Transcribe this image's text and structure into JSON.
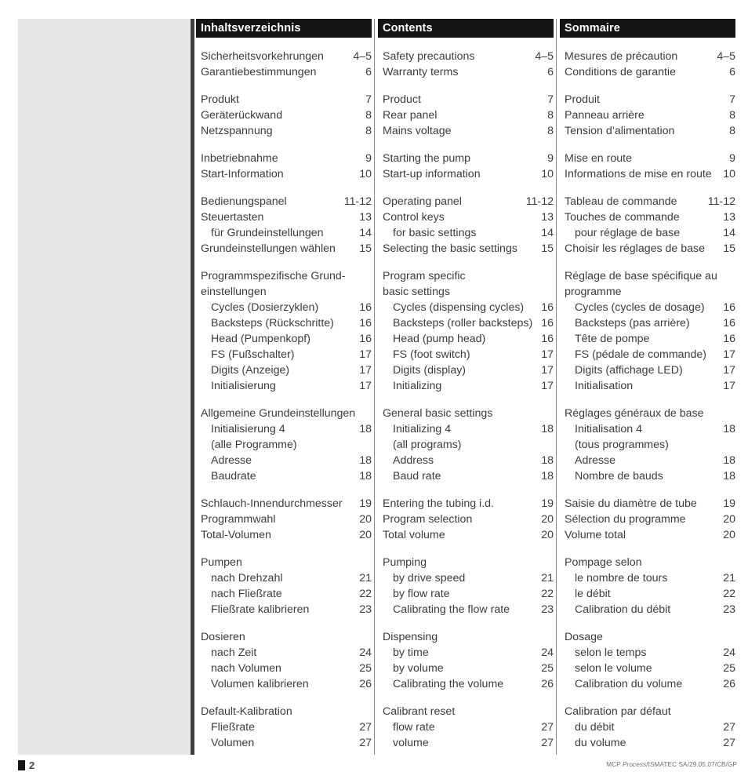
{
  "document": {
    "footer": {
      "page_marker": "square-marker",
      "page_number": "2",
      "reference_prefix": "MCP ",
      "reference_italic": "Process",
      "reference_suffix": "/ISMATEC SA/29.05.07/CB/GP"
    }
  },
  "columns": [
    {
      "id": "de",
      "language": "German",
      "header": "Inhaltsverzeichnis",
      "groups": [
        {
          "rows": [
            {
              "label": "Sicherheitsvorkehrungen",
              "page": "4–5",
              "indent": false
            },
            {
              "label": "Garantiebestimmungen",
              "page": "6",
              "indent": false
            }
          ]
        },
        {
          "rows": [
            {
              "label": "Produkt",
              "page": "7",
              "indent": false
            },
            {
              "label": "Geräterückwand",
              "page": "8",
              "indent": false
            },
            {
              "label": "Netzspannung",
              "page": "8",
              "indent": false
            }
          ]
        },
        {
          "rows": [
            {
              "label": "Inbetriebnahme",
              "page": "9",
              "indent": false
            },
            {
              "label": "Start-Information",
              "page": "10",
              "indent": false
            }
          ]
        },
        {
          "rows": [
            {
              "label": "Bedienungspanel",
              "page": "11-12",
              "indent": false
            },
            {
              "label": "Steuertasten",
              "page": "13",
              "indent": false
            },
            {
              "label": "für Grundeinstellungen",
              "page": "14",
              "indent": true
            },
            {
              "label": "Grundeinstellungen wählen",
              "page": "15",
              "indent": false
            }
          ]
        },
        {
          "rows": [
            {
              "label": "Programmspezifische Grund-",
              "page": "",
              "indent": false,
              "cont": true
            },
            {
              "label": "einstellungen",
              "page": "",
              "indent": false,
              "cont": true
            },
            {
              "label": "Cycles (Dosierzyklen)",
              "page": "16",
              "indent": true
            },
            {
              "label": "Backsteps (Rückschritte)",
              "page": "16",
              "indent": true
            },
            {
              "label": "Head (Pumpenkopf)",
              "page": "16",
              "indent": true
            },
            {
              "label": "FS (Fußschalter)",
              "page": "17",
              "indent": true
            },
            {
              "label": "Digits (Anzeige)",
              "page": "17",
              "indent": true
            },
            {
              "label": "Initialisierung",
              "page": "17",
              "indent": true
            }
          ]
        },
        {
          "rows": [
            {
              "label": "Allgemeine Grundeinstellungen",
              "page": "",
              "indent": false,
              "cont": true
            },
            {
              "label": "Initialisierung 4",
              "page": "18",
              "indent": true
            },
            {
              "label": "(alle Programme)",
              "page": "",
              "indent": true,
              "cont": true
            },
            {
              "label": "Adresse",
              "page": "18",
              "indent": true
            },
            {
              "label": "Baudrate",
              "page": "18",
              "indent": true
            }
          ]
        },
        {
          "rows": [
            {
              "label": "Schlauch-Innendurchmesser",
              "page": "19",
              "indent": false
            },
            {
              "label": "Programmwahl",
              "page": "20",
              "indent": false
            },
            {
              "label": "Total-Volumen",
              "page": "20",
              "indent": false
            }
          ]
        },
        {
          "rows": [
            {
              "label": "Pumpen",
              "page": "",
              "indent": false,
              "cont": true
            },
            {
              "label": "nach Drehzahl",
              "page": "21",
              "indent": true
            },
            {
              "label": "nach Fließrate",
              "page": "22",
              "indent": true
            },
            {
              "label": "Fließrate kalibrieren",
              "page": "23",
              "indent": true
            }
          ]
        },
        {
          "rows": [
            {
              "label": "Dosieren",
              "page": "",
              "indent": false,
              "cont": true
            },
            {
              "label": "nach Zeit",
              "page": "24",
              "indent": true
            },
            {
              "label": "nach Volumen",
              "page": "25",
              "indent": true
            },
            {
              "label": "Volumen kalibrieren",
              "page": "26",
              "indent": true
            }
          ]
        },
        {
          "rows": [
            {
              "label": "Default-Kalibration",
              "page": "",
              "indent": false,
              "cont": true
            },
            {
              "label": "Fließrate",
              "page": "27",
              "indent": true
            },
            {
              "label": "Volumen",
              "page": "27",
              "indent": true
            }
          ]
        }
      ]
    },
    {
      "id": "en",
      "language": "English",
      "header": "Contents",
      "groups": [
        {
          "rows": [
            {
              "label": "Safety precautions",
              "page": "4–5",
              "indent": false
            },
            {
              "label": "Warranty terms",
              "page": "6",
              "indent": false
            }
          ]
        },
        {
          "rows": [
            {
              "label": "Product",
              "page": "7",
              "indent": false
            },
            {
              "label": "Rear panel",
              "page": "8",
              "indent": false
            },
            {
              "label": "Mains voltage",
              "page": "8",
              "indent": false
            }
          ]
        },
        {
          "rows": [
            {
              "label": "Starting the pump",
              "page": "9",
              "indent": false
            },
            {
              "label": "Start-up information",
              "page": "10",
              "indent": false
            }
          ]
        },
        {
          "rows": [
            {
              "label": "Operating panel",
              "page": "11-12",
              "indent": false
            },
            {
              "label": "Control keys",
              "page": "13",
              "indent": false
            },
            {
              "label": "for basic settings",
              "page": "14",
              "indent": true
            },
            {
              "label": "Selecting the basic settings",
              "page": "15",
              "indent": false
            }
          ]
        },
        {
          "rows": [
            {
              "label": "Program specific",
              "page": "",
              "indent": false,
              "cont": true
            },
            {
              "label": "basic settings",
              "page": "",
              "indent": false,
              "cont": true
            },
            {
              "label": "Cycles (dispensing cycles)",
              "page": "16",
              "indent": true
            },
            {
              "label": "Backsteps (roller backsteps)",
              "page": "16",
              "indent": true
            },
            {
              "label": "Head (pump head)",
              "page": "16",
              "indent": true
            },
            {
              "label": "FS (foot switch)",
              "page": "17",
              "indent": true
            },
            {
              "label": "Digits (display)",
              "page": "17",
              "indent": true
            },
            {
              "label": "Initializing",
              "page": "17",
              "indent": true
            }
          ]
        },
        {
          "rows": [
            {
              "label": "General basic settings",
              "page": "",
              "indent": false,
              "cont": true
            },
            {
              "label": "Initializing 4",
              "page": "18",
              "indent": true
            },
            {
              "label": "(all programs)",
              "page": "",
              "indent": true,
              "cont": true
            },
            {
              "label": "Address",
              "page": "18",
              "indent": true
            },
            {
              "label": "Baud rate",
              "page": "18",
              "indent": true
            }
          ]
        },
        {
          "rows": [
            {
              "label": "Entering the tubing i.d.",
              "page": "19",
              "indent": false
            },
            {
              "label": "Program selection",
              "page": "20",
              "indent": false
            },
            {
              "label": "Total volume",
              "page": "20",
              "indent": false
            }
          ]
        },
        {
          "rows": [
            {
              "label": "Pumping",
              "page": "",
              "indent": false,
              "cont": true
            },
            {
              "label": "by drive speed",
              "page": "21",
              "indent": true
            },
            {
              "label": "by flow rate",
              "page": "22",
              "indent": true
            },
            {
              "label": "Calibrating the flow rate",
              "page": "23",
              "indent": true
            }
          ]
        },
        {
          "rows": [
            {
              "label": "Dispensing",
              "page": "",
              "indent": false,
              "cont": true
            },
            {
              "label": "by time",
              "page": "24",
              "indent": true
            },
            {
              "label": "by volume",
              "page": "25",
              "indent": true
            },
            {
              "label": "Calibrating the volume",
              "page": "26",
              "indent": true
            }
          ]
        },
        {
          "rows": [
            {
              "label": "Calibrant reset",
              "page": "",
              "indent": false,
              "cont": true
            },
            {
              "label": "flow rate",
              "page": "27",
              "indent": true
            },
            {
              "label": "volume",
              "page": "27",
              "indent": true
            }
          ]
        }
      ]
    },
    {
      "id": "fr",
      "language": "French",
      "header": "Sommaire",
      "groups": [
        {
          "rows": [
            {
              "label": "Mesures de précaution",
              "page": "4–5",
              "indent": false
            },
            {
              "label": "Conditions de garantie",
              "page": "6",
              "indent": false
            }
          ]
        },
        {
          "rows": [
            {
              "label": "Produit",
              "page": "7",
              "indent": false
            },
            {
              "label": "Panneau arrière",
              "page": "8",
              "indent": false
            },
            {
              "label": "Tension d’alimentation",
              "page": "8",
              "indent": false
            }
          ]
        },
        {
          "rows": [
            {
              "label": "Mise en route",
              "page": "9",
              "indent": false
            },
            {
              "label": "Informations de mise en route",
              "page": "10",
              "indent": false
            }
          ]
        },
        {
          "rows": [
            {
              "label": "Tableau de commande",
              "page": "11-12",
              "indent": false
            },
            {
              "label": "Touches de commande",
              "page": "13",
              "indent": false
            },
            {
              "label": "pour réglage de base",
              "page": "14",
              "indent": true
            },
            {
              "label": "Choisir les réglages de base",
              "page": "15",
              "indent": false
            }
          ]
        },
        {
          "rows": [
            {
              "label": "Réglage de base spécifique au",
              "page": "",
              "indent": false,
              "cont": true
            },
            {
              "label": "programme",
              "page": "",
              "indent": false,
              "cont": true
            },
            {
              "label": "Cycles (cycles de dosage)",
              "page": "16",
              "indent": true
            },
            {
              "label": "Backsteps (pas arrière)",
              "page": "16",
              "indent": true
            },
            {
              "label": "Tête de pompe",
              "page": "16",
              "indent": true
            },
            {
              "label": "FS (pédale de commande)",
              "page": "17",
              "indent": true
            },
            {
              "label": "Digits (affichage LED)",
              "page": "17",
              "indent": true
            },
            {
              "label": "Initialisation",
              "page": "17",
              "indent": true
            }
          ]
        },
        {
          "rows": [
            {
              "label": "Réglages généraux de base",
              "page": "",
              "indent": false,
              "cont": true
            },
            {
              "label": "Initialisation 4",
              "page": "18",
              "indent": true
            },
            {
              "label": "(tous programmes)",
              "page": "",
              "indent": true,
              "cont": true
            },
            {
              "label": "Adresse",
              "page": "18",
              "indent": true
            },
            {
              "label": "Nombre de bauds",
              "page": "18",
              "indent": true
            }
          ]
        },
        {
          "rows": [
            {
              "label": "Saisie du diamètre de tube",
              "page": "19",
              "indent": false
            },
            {
              "label": "Sélection du programme",
              "page": "20",
              "indent": false
            },
            {
              "label": "Volume total",
              "page": "20",
              "indent": false
            }
          ]
        },
        {
          "rows": [
            {
              "label": "Pompage selon",
              "page": "",
              "indent": false,
              "cont": true
            },
            {
              "label": "le nombre de tours",
              "page": "21",
              "indent": true
            },
            {
              "label": "le débit",
              "page": "22",
              "indent": true
            },
            {
              "label": "Calibration du débit",
              "page": "23",
              "indent": true
            }
          ]
        },
        {
          "rows": [
            {
              "label": "Dosage",
              "page": "",
              "indent": false,
              "cont": true
            },
            {
              "label": "selon le temps",
              "page": "24",
              "indent": true
            },
            {
              "label": "selon le volume",
              "page": "25",
              "indent": true
            },
            {
              "label": "Calibration du volume",
              "page": "26",
              "indent": true
            }
          ]
        },
        {
          "rows": [
            {
              "label": "Calibration par défaut",
              "page": "",
              "indent": false,
              "cont": true
            },
            {
              "label": "du débit",
              "page": "27",
              "indent": true
            },
            {
              "label": "du volume",
              "page": "27",
              "indent": true
            }
          ]
        }
      ]
    }
  ],
  "colors": {
    "header_bar": "#151515",
    "text": "#3c3c3c",
    "panel_gray": "#e6e6e6",
    "rule_dark": "#3f3f3f",
    "rule_light": "#8c8c8c"
  }
}
